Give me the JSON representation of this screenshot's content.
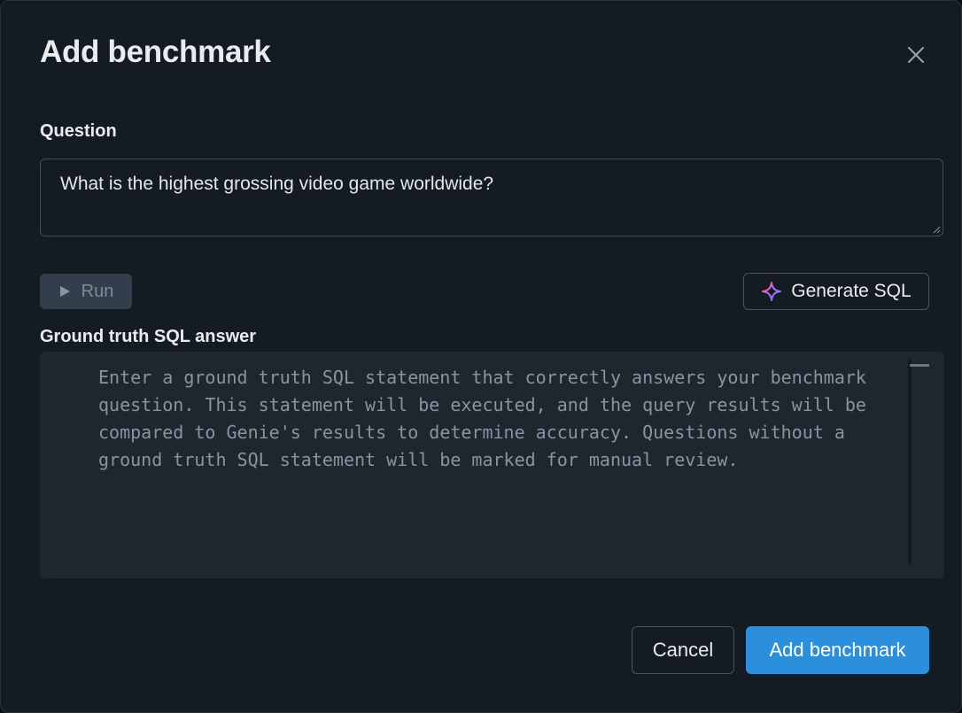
{
  "dialog": {
    "title": "Add benchmark",
    "close_icon": "close-icon"
  },
  "question": {
    "label": "Question",
    "value": "What is the highest grossing video game worldwide?"
  },
  "toolbar": {
    "run_label": "Run",
    "run_icon": "play-icon",
    "generate_label": "Generate SQL",
    "generate_icon": "sparkle-icon"
  },
  "sql": {
    "label": "Ground truth SQL answer",
    "placeholder": "Enter a ground truth SQL statement that correctly answers your benchmark\nquestion. This statement will be executed, and the query results will be\ncompared to Genie's results to determine accuracy. Questions without a\nground truth SQL statement will be marked for manual review."
  },
  "footer": {
    "cancel_label": "Cancel",
    "submit_label": "Add benchmark"
  },
  "colors": {
    "accent": "#2b8fdc",
    "background": "#141b22",
    "editor_background": "#1f262f"
  }
}
